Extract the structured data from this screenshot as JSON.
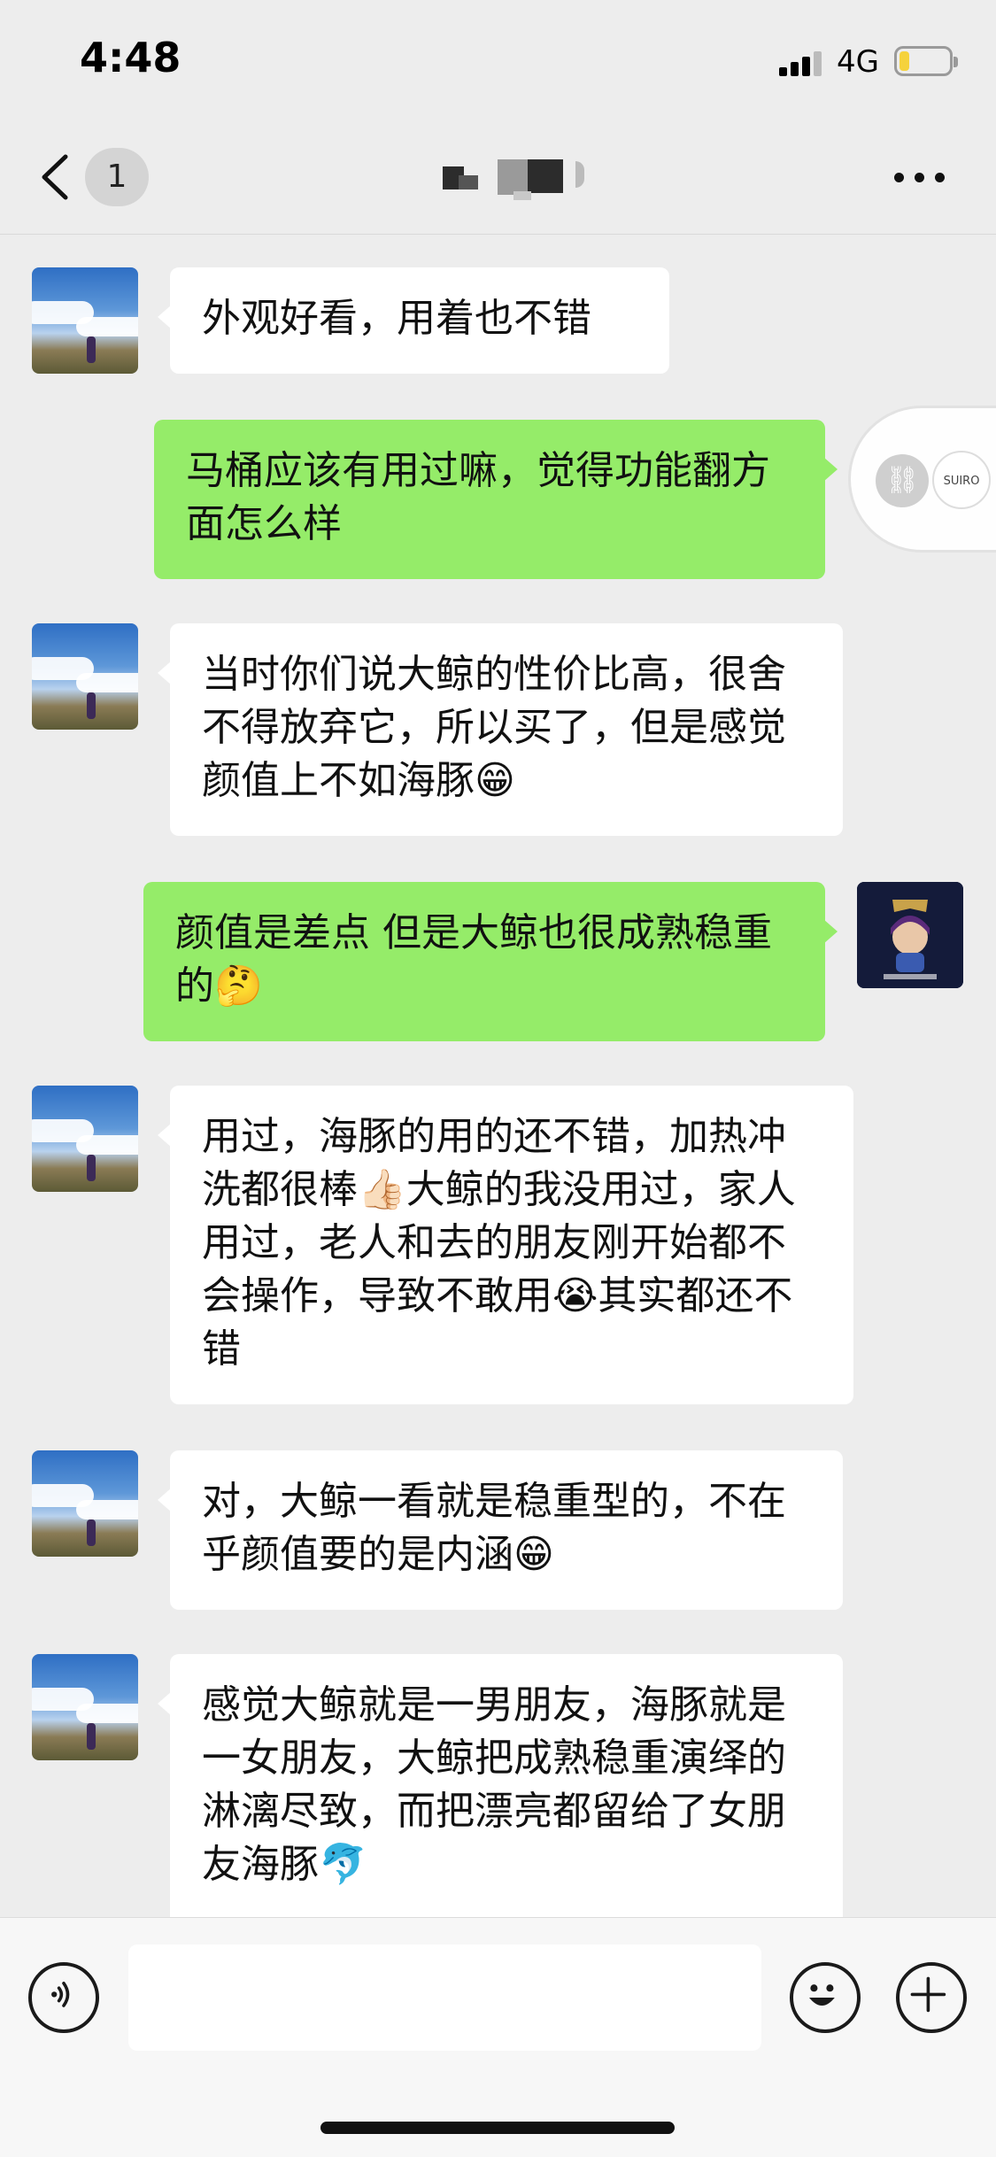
{
  "status_bar": {
    "time": "4:48",
    "network": "4G",
    "battery_level": 0.2
  },
  "nav": {
    "unread_count": "1"
  },
  "messages": [
    {
      "direction": "in",
      "text": "外观好看，用着也不错"
    },
    {
      "direction": "out",
      "text": "马桶应该有用过嘛，觉得功能翻方面怎么样"
    },
    {
      "direction": "in",
      "text": "当时你们说大鲸的性价比高，很舍不得放弃它，所以买了，但是感觉颜值上不如海豚😁"
    },
    {
      "direction": "out",
      "text": "颜值是差点 但是大鲸也很成熟稳重的🤔"
    },
    {
      "direction": "in",
      "text": "用过，海豚的用的还不错，加热冲洗都很棒👍🏻大鲸的我没用过，家人用过，老人和去的朋友刚开始都不会操作，导致不敢用😭其实都还不错"
    },
    {
      "direction": "in",
      "text": "对，大鲸一看就是稳重型的，不在乎颜值要的是内涵😁"
    },
    {
      "direction": "in",
      "text": "感觉大鲸就是一男朋友，海豚就是一女朋友，大鲸把成熟稳重演绎的淋漓尽致，而把漂亮都留给了女朋友海豚🐬"
    }
  ],
  "float_widget": {
    "logo_text": "SUIRO"
  },
  "colors": {
    "incoming_bubble": "#ffffff",
    "outgoing_bubble": "#95ec69",
    "background": "#ededed"
  },
  "icons": [
    "back-chevron-icon",
    "more-icon",
    "voice-icon",
    "emoji-icon",
    "plus-icon",
    "link-icon"
  ]
}
